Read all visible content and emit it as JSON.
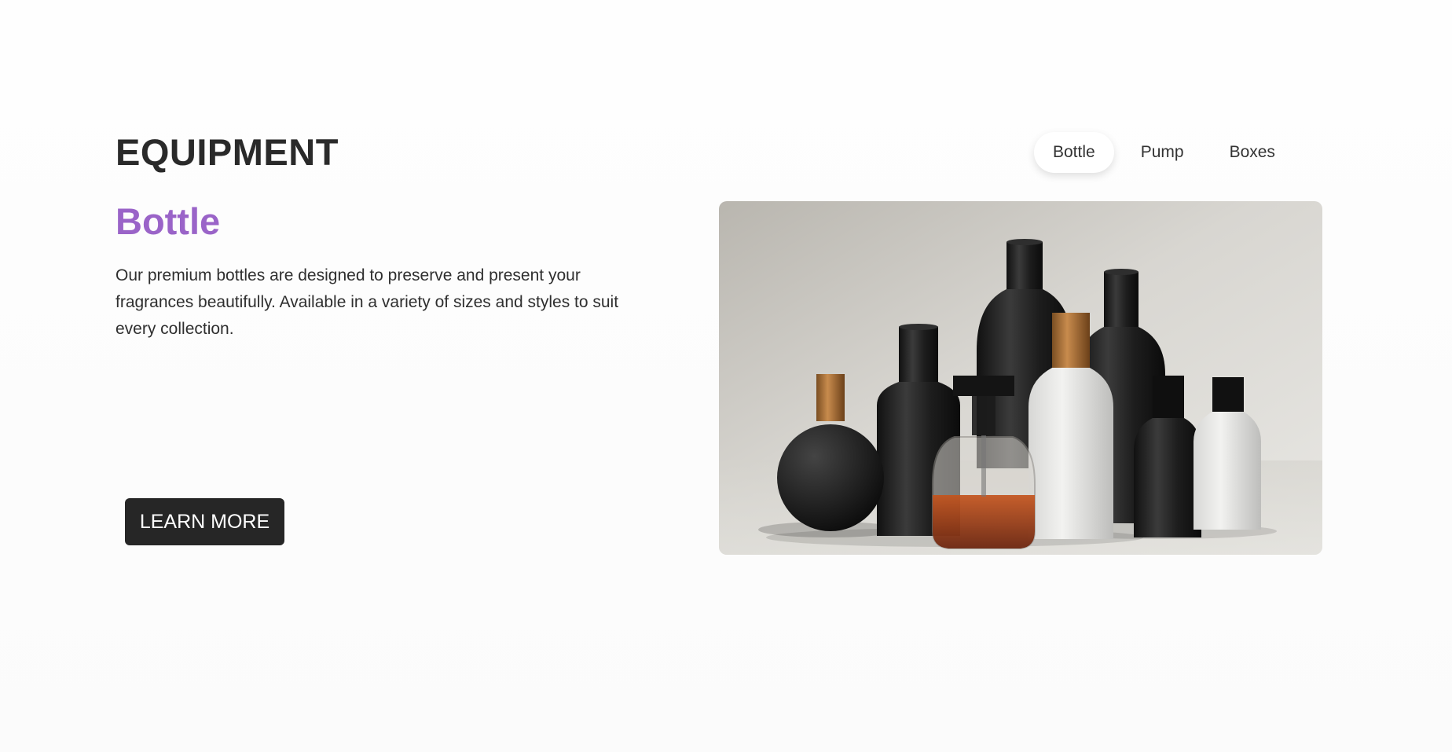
{
  "header": {
    "title": "EQUIPMENT"
  },
  "tabs": [
    {
      "label": "Bottle",
      "active": true
    },
    {
      "label": "Pump",
      "active": false
    },
    {
      "label": "Boxes",
      "active": false
    }
  ],
  "product": {
    "title": "Bottle",
    "description": "Our premium bottles are designed to preserve and present your fragrances beautifully. Available in a variety of sizes and styles to suit every collection.",
    "cta_label": "LEARN MORE",
    "image_icon": "bottle-collection-image"
  },
  "colors": {
    "accent": "#9a64c8",
    "button_bg": "#262626",
    "text": "#2b2b2b"
  }
}
